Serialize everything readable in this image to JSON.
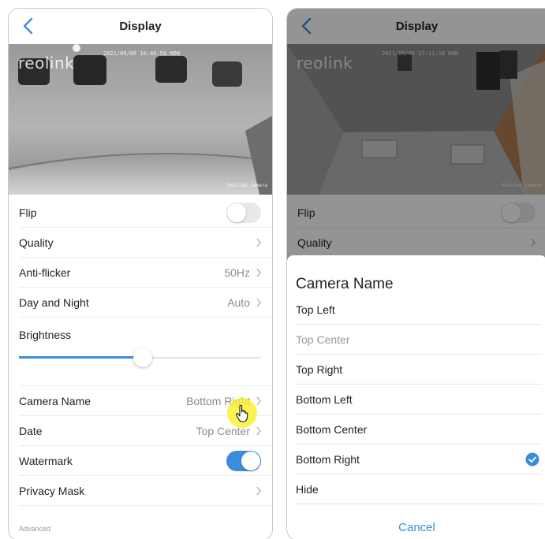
{
  "left": {
    "nav": {
      "title": "Display"
    },
    "feed": {
      "logo": "reolink",
      "timestamp": "2021/09/06 16:46:58 MON",
      "camera_name": "Reolink camera"
    },
    "settings": {
      "flip": {
        "label": "Flip",
        "enabled": false
      },
      "quality": {
        "label": "Quality"
      },
      "anti_flicker": {
        "label": "Anti-flicker",
        "value": "50Hz"
      },
      "day_night": {
        "label": "Day and Night",
        "value": "Auto"
      },
      "brightness": {
        "label": "Brightness",
        "level": 0.51
      },
      "camera_name": {
        "label": "Camera Name",
        "value": "Bottom Right"
      },
      "date": {
        "label": "Date",
        "value": "Top Center"
      },
      "watermark": {
        "label": "Watermark",
        "enabled": true
      },
      "privacy_mask": {
        "label": "Privacy Mask"
      },
      "advanced_label": "Advanced"
    }
  },
  "right": {
    "nav": {
      "title": "Display"
    },
    "feed": {
      "logo": "reolink",
      "timestamp": "2021/09/06 17:11:18 MON",
      "camera_name": "Reolink camera"
    },
    "settings": {
      "flip": {
        "label": "Flip"
      },
      "quality": {
        "label": "Quality"
      }
    },
    "sheet": {
      "title": "Camera Name",
      "options": [
        {
          "label": "Top Left",
          "state": "normal"
        },
        {
          "label": "Top Center",
          "state": "disabled"
        },
        {
          "label": "Top Right",
          "state": "normal"
        },
        {
          "label": "Bottom Left",
          "state": "normal"
        },
        {
          "label": "Bottom Center",
          "state": "normal"
        },
        {
          "label": "Bottom Right",
          "state": "selected"
        },
        {
          "label": "Hide",
          "state": "normal"
        }
      ],
      "cancel": "Cancel"
    }
  },
  "colors": {
    "accent": "#3a8dde",
    "highlight": "#faf028"
  },
  "icons": [
    "back-chevron-icon",
    "chevron-right-icon",
    "check-circle-icon",
    "hand-pointer-icon"
  ]
}
